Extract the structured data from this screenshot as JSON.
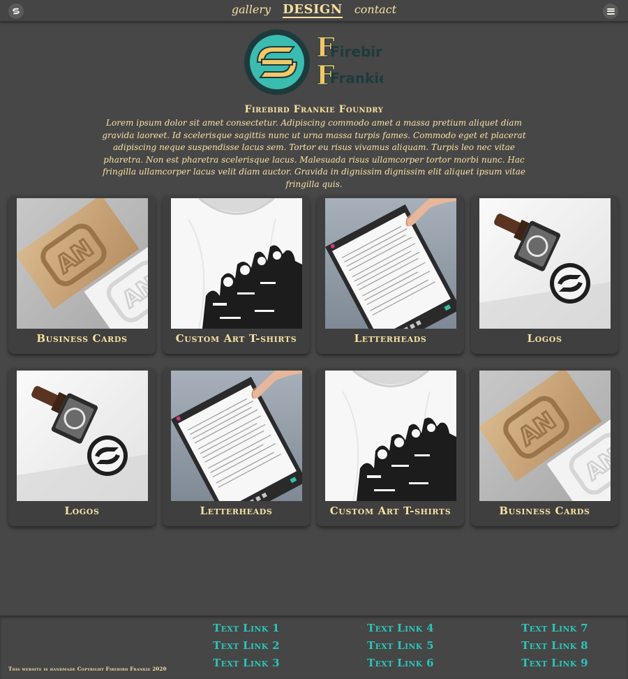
{
  "header": {
    "nav": [
      {
        "label": "gallery",
        "active": false
      },
      {
        "label": "DESIGN",
        "active": true
      },
      {
        "label": "contact",
        "active": false
      }
    ],
    "logo_icon": "firebird-monogram-icon",
    "menu_icon": "hamburger-menu-icon"
  },
  "hero": {
    "logo_text_line1": "Firebird",
    "logo_text_line2": "Frankie",
    "title": "Firebird Frankie Foundry",
    "intro": "Lorem ipsum dolor sit amet consectetur. Adipiscing commodo amet a massa pretium aliquet diam gravida laoreet. Id scelerisque sagittis nunc ut urna massa turpis fames. Commodo eget et placerat adipiscing neque suspendisse lacus sem. Tortor eu risus vivamus aliquam. Turpis leo nec vitae pharetra. Non est pharetra scelerisque lacus. Malesuada risus ullamcorper tortor morbi nunc. Hac fringilla ullamcorper lacus velit diam auctor. Gravida in dignissim dignissim elit aliquet ipsum vitae fringilla quis."
  },
  "gallery": [
    {
      "label": "Business Cards",
      "image": "business-cards"
    },
    {
      "label": "Custom Art T-shirts",
      "image": "tshirt"
    },
    {
      "label": "Letterheads",
      "image": "letterhead"
    },
    {
      "label": "Logos",
      "image": "stamp"
    },
    {
      "label": "Logos",
      "image": "stamp"
    },
    {
      "label": "Letterheads",
      "image": "letterhead"
    },
    {
      "label": "Custom Art T-shirts",
      "image": "tshirt"
    },
    {
      "label": "Business Cards",
      "image": "business-cards"
    }
  ],
  "footer": {
    "copyright": "This website is handmade Copyright Firebird Frankie 2020",
    "links": [
      "Text Link 1",
      "Text Link 2",
      "Text Link 3",
      "Text Link 4",
      "Text Link 5",
      "Text Link 6",
      "Text Link 7",
      "Text Link 8",
      "Text Link 9"
    ]
  },
  "colors": {
    "background": "#474747",
    "cream": "#f6e1a3",
    "teal": "#2bc6ba",
    "logo_teal": "#3bbcb0",
    "logo_yellow": "#f3c867",
    "logo_dark": "#1f3b3d"
  }
}
